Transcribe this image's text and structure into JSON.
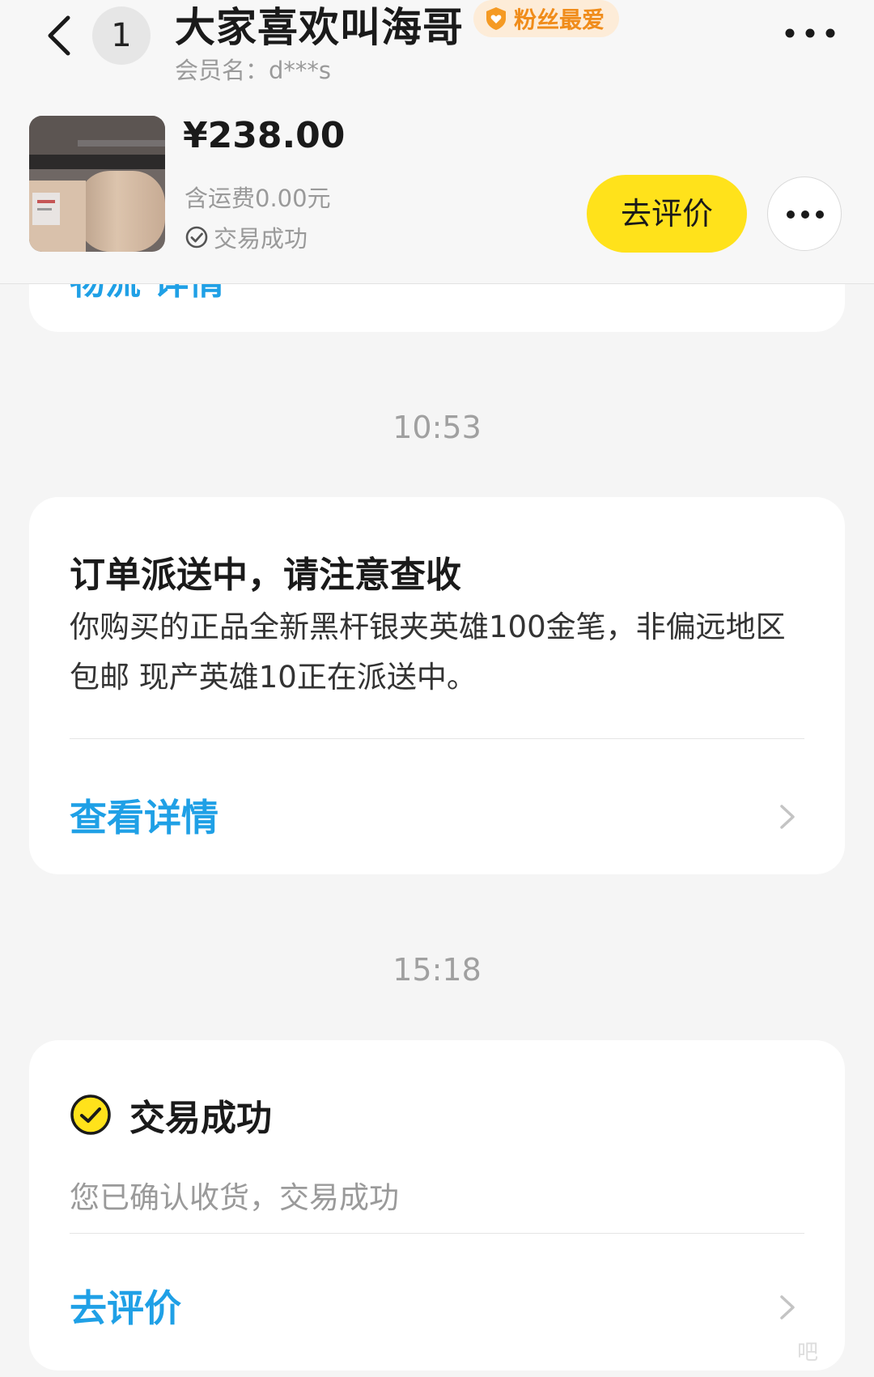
{
  "header": {
    "unread_count": "1",
    "seller_name": "大家喜欢叫海哥",
    "fan_badge": "粉丝最爱",
    "member_label": "会员名：d***s"
  },
  "product": {
    "price": "¥238.00",
    "shipping": "含运费0.00元",
    "status": "交易成功",
    "review_button": "去评价"
  },
  "chat": {
    "previous_card_link": "物流 详情",
    "timestamps": [
      "10:53",
      "15:18"
    ],
    "shipping_card": {
      "title": "订单派送中，请注意查收",
      "body": "你购买的正品全新黑杆银夹英雄100金笔，非偏远地区包邮 现产英雄10正在派送中。",
      "link": "查看详情"
    },
    "success_card": {
      "title": "交易成功",
      "description": "您已确认收货，交易成功",
      "link": "去评价"
    }
  },
  "watermark": "吧",
  "colors": {
    "accent_yellow": "#ffe21b",
    "link_blue": "#1fa0e6",
    "badge_orange": "#f08c1a",
    "background": "#f5f5f5"
  },
  "icons": [
    "back-arrow-icon",
    "shield-heart-icon",
    "more-dots-icon",
    "check-circle-icon",
    "chevron-right-icon"
  ]
}
